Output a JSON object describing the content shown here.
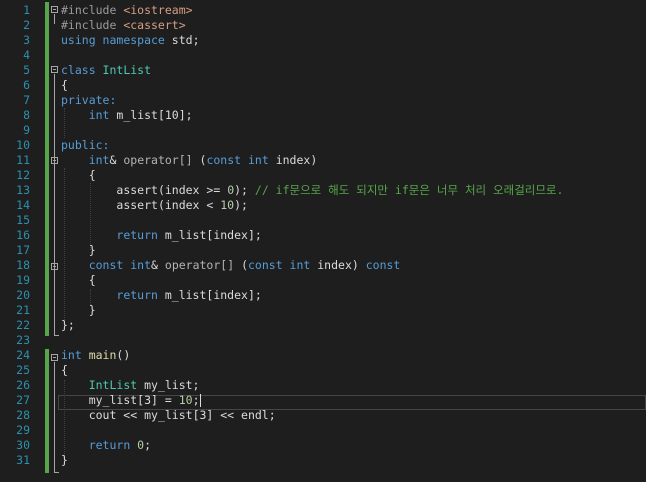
{
  "editor": {
    "colors": {
      "background": "#1e1e1e",
      "line_number": "#2b91af",
      "keyword": "#569cd6",
      "type": "#4ec9b0",
      "comment": "#57a64a",
      "number": "#b5cea8",
      "include_path": "#d69d85"
    },
    "line_numbers": [
      "1",
      "2",
      "3",
      "4",
      "5",
      "6",
      "7",
      "8",
      "9",
      "10",
      "11",
      "12",
      "13",
      "14",
      "15",
      "16",
      "17",
      "18",
      "19",
      "20",
      "21",
      "22",
      "23",
      "24",
      "25",
      "26",
      "27",
      "28",
      "29",
      "30",
      "31"
    ],
    "lines": [
      [
        {
          "t": "#include ",
          "c": "pp"
        },
        {
          "t": "<iostream>",
          "c": "str"
        }
      ],
      [
        {
          "t": "#include ",
          "c": "pp"
        },
        {
          "t": "<cassert>",
          "c": "str"
        }
      ],
      [
        {
          "t": "using ",
          "c": "kw"
        },
        {
          "t": "namespace ",
          "c": "kw"
        },
        {
          "t": "std;",
          "c": "pr"
        }
      ],
      [],
      [
        {
          "t": "class ",
          "c": "kw"
        },
        {
          "t": "IntList",
          "c": "ty"
        }
      ],
      [
        {
          "t": "{",
          "c": "pr"
        }
      ],
      [
        {
          "t": "private:",
          "c": "kw"
        }
      ],
      [
        {
          "t": "    ",
          "c": "pr"
        },
        {
          "t": "int ",
          "c": "kw"
        },
        {
          "t": "m_list",
          "c": "var"
        },
        {
          "t": "[10];",
          "c": "pr"
        }
      ],
      [],
      [
        {
          "t": "public:",
          "c": "kw"
        }
      ],
      [
        {
          "t": "    ",
          "c": "pr"
        },
        {
          "t": "int",
          "c": "kw"
        },
        {
          "t": "& ",
          "c": "pr"
        },
        {
          "t": "operator[]",
          "c": "op"
        },
        {
          "t": " (",
          "c": "pr"
        },
        {
          "t": "const ",
          "c": "kw"
        },
        {
          "t": "int ",
          "c": "kw"
        },
        {
          "t": "index)",
          "c": "pr"
        }
      ],
      [
        {
          "t": "    {",
          "c": "pr"
        }
      ],
      [
        {
          "t": "        ",
          "c": "pr"
        },
        {
          "t": "assert",
          "c": "var"
        },
        {
          "t": "(index >= ",
          "c": "pr"
        },
        {
          "t": "0",
          "c": "num"
        },
        {
          "t": "); ",
          "c": "pr"
        },
        {
          "t": "// if문으로 해도 되지만 if문은 너무 처리 오래걸리므로.",
          "c": "com"
        }
      ],
      [
        {
          "t": "        ",
          "c": "pr"
        },
        {
          "t": "assert",
          "c": "var"
        },
        {
          "t": "(index < ",
          "c": "pr"
        },
        {
          "t": "10",
          "c": "num"
        },
        {
          "t": ");",
          "c": "pr"
        }
      ],
      [],
      [
        {
          "t": "        ",
          "c": "pr"
        },
        {
          "t": "return ",
          "c": "kw"
        },
        {
          "t": "m_list",
          "c": "var"
        },
        {
          "t": "[index];",
          "c": "pr"
        }
      ],
      [
        {
          "t": "    }",
          "c": "pr"
        }
      ],
      [
        {
          "t": "    ",
          "c": "pr"
        },
        {
          "t": "const ",
          "c": "kw"
        },
        {
          "t": "int",
          "c": "kw"
        },
        {
          "t": "& ",
          "c": "pr"
        },
        {
          "t": "operator[]",
          "c": "op"
        },
        {
          "t": " (",
          "c": "pr"
        },
        {
          "t": "const ",
          "c": "kw"
        },
        {
          "t": "int ",
          "c": "kw"
        },
        {
          "t": "index) ",
          "c": "pr"
        },
        {
          "t": "const",
          "c": "kw"
        }
      ],
      [
        {
          "t": "    {",
          "c": "pr"
        }
      ],
      [
        {
          "t": "        ",
          "c": "pr"
        },
        {
          "t": "return ",
          "c": "kw"
        },
        {
          "t": "m_list",
          "c": "var"
        },
        {
          "t": "[index];",
          "c": "pr"
        }
      ],
      [
        {
          "t": "    }",
          "c": "pr"
        }
      ],
      [
        {
          "t": "};",
          "c": "pr"
        }
      ],
      [],
      [
        {
          "t": "int ",
          "c": "kw"
        },
        {
          "t": "main",
          "c": "fn"
        },
        {
          "t": "()",
          "c": "pr"
        }
      ],
      [
        {
          "t": "{",
          "c": "pr"
        }
      ],
      [
        {
          "t": "    ",
          "c": "pr"
        },
        {
          "t": "IntList ",
          "c": "ty"
        },
        {
          "t": "my_list;",
          "c": "var"
        }
      ],
      [
        {
          "t": "    ",
          "c": "pr"
        },
        {
          "t": "my_list",
          "c": "var"
        },
        {
          "t": "[3] = ",
          "c": "pr"
        },
        {
          "t": "10",
          "c": "num"
        },
        {
          "t": ";",
          "c": "pr"
        }
      ],
      [
        {
          "t": "    cout << ",
          "c": "pr"
        },
        {
          "t": "my_list",
          "c": "var"
        },
        {
          "t": "[3] << endl;",
          "c": "pr"
        }
      ],
      [],
      [
        {
          "t": "    ",
          "c": "pr"
        },
        {
          "t": "return ",
          "c": "kw"
        },
        {
          "t": "0",
          "c": "num"
        },
        {
          "t": ";",
          "c": "pr"
        }
      ],
      [
        {
          "t": "}",
          "c": "pr"
        }
      ]
    ]
  }
}
